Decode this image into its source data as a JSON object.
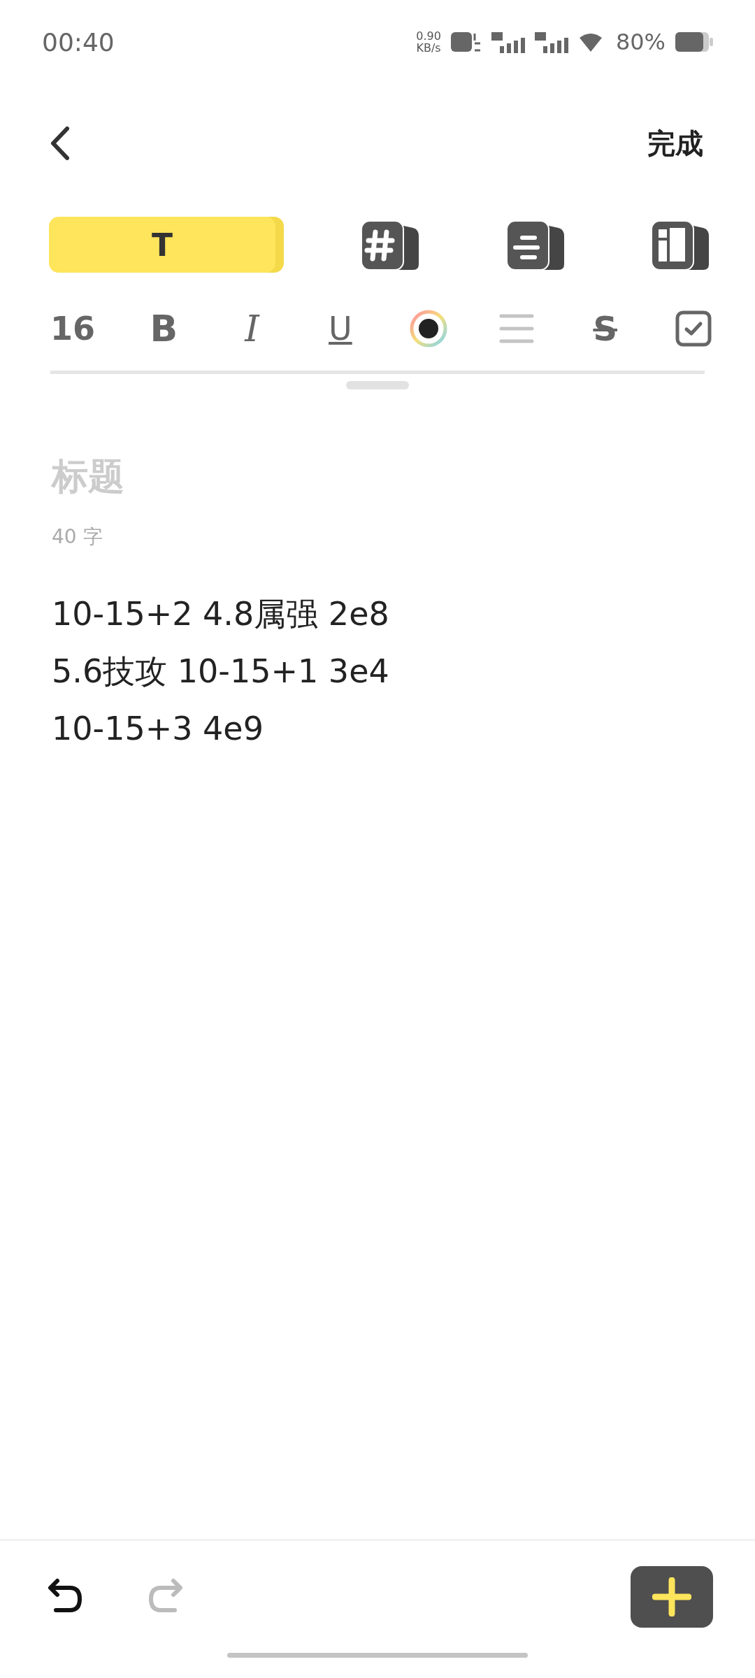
{
  "status_bar": {
    "time": "00:40",
    "speed_value": "0.90",
    "speed_unit": "KB/s",
    "battery": "80%"
  },
  "header": {
    "done": "完成"
  },
  "mode_tabs": [
    {
      "kind": "text",
      "label": "T",
      "selected": true
    },
    {
      "kind": "tag",
      "selected": false
    },
    {
      "kind": "list",
      "selected": false
    },
    {
      "kind": "layout",
      "selected": false
    }
  ],
  "format_tools": [
    {
      "kind": "size",
      "label": "16",
      "disabled": false
    },
    {
      "kind": "bold",
      "label": "B",
      "disabled": false
    },
    {
      "kind": "italic",
      "label": "I",
      "disabled": false
    },
    {
      "kind": "underline",
      "label": "U",
      "disabled": false
    },
    {
      "kind": "color",
      "disabled": false
    },
    {
      "kind": "align",
      "disabled": true
    },
    {
      "kind": "strike",
      "label": "S",
      "disabled": false
    },
    {
      "kind": "checkbox",
      "disabled": false
    }
  ],
  "note": {
    "title_placeholder": "标题",
    "word_count": "40 字",
    "lines": [
      "10-15+2 4.8属强 2e8",
      "5.6技攻 10-15+1 3e4",
      "10-15+3 4e9"
    ]
  },
  "bottom_bar": {
    "undo_disabled": false,
    "redo_disabled": true
  }
}
